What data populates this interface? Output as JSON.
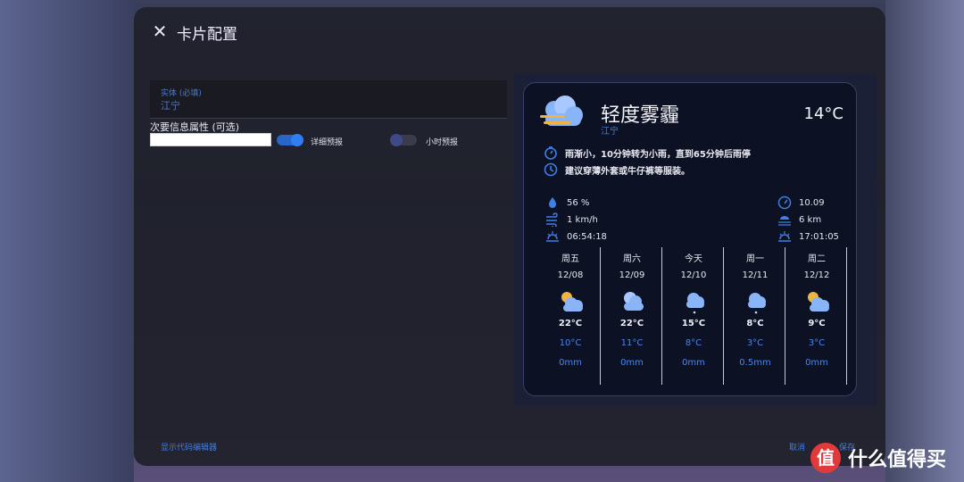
{
  "dialog": {
    "title": "卡片配置",
    "close_icon": "close-icon"
  },
  "form": {
    "entity_label": "实体 (必填)",
    "entity_value": "江宁",
    "secondary_label": "次要信息属性 (可选)",
    "secondary_value": "",
    "toggle_detail_label": "详细预报",
    "toggle_detail_on": true,
    "toggle_hourly_label": "小时预报",
    "toggle_hourly_on": false
  },
  "card": {
    "condition": "轻度雾霾",
    "location": "江宁",
    "temperature": "14°C",
    "alert_text": "雨渐小，10分钟转为小雨，直到65分钟后雨停",
    "advice_text": "建议穿薄外套或牛仔裤等服装。",
    "stats_left": [
      {
        "icon": "humidity-icon",
        "value": "56 %"
      },
      {
        "icon": "wind-icon",
        "value": "1 km/h"
      },
      {
        "icon": "sunrise-icon",
        "value": "06:54:18"
      }
    ],
    "stats_right": [
      {
        "icon": "pressure-gauge-icon",
        "value": "10.09"
      },
      {
        "icon": "visibility-icon",
        "value": "6 km"
      },
      {
        "icon": "sunset-icon",
        "value": "17:01:05"
      }
    ],
    "forecast": [
      {
        "day": "周五",
        "date": "12/08",
        "icon": "sun-cloud-icon",
        "high": "22°C",
        "low": "10°C",
        "rain": "0mm"
      },
      {
        "day": "周六",
        "date": "12/09",
        "icon": "cloud-icon",
        "high": "22°C",
        "low": "11°C",
        "rain": "0mm"
      },
      {
        "day": "今天",
        "date": "12/10",
        "icon": "rain-cloud-icon",
        "high": "15°C",
        "low": "8°C",
        "rain": "0mm"
      },
      {
        "day": "周一",
        "date": "12/11",
        "icon": "rain-cloud-icon",
        "high": "8°C",
        "low": "3°C",
        "rain": "0.5mm"
      },
      {
        "day": "周二",
        "date": "12/12",
        "icon": "sun-cloud-icon",
        "high": "9°C",
        "low": "3°C",
        "rain": "0mm"
      }
    ]
  },
  "footer": {
    "code_editor_link": "显示代码编辑器",
    "cancel": "取消",
    "save": "保存"
  },
  "watermark": {
    "logo_char": "值",
    "text": "什么值得买"
  },
  "colors": {
    "accent": "#3f7ee4",
    "card_bg": "#0c1224",
    "dialog_bg": "#20212a"
  }
}
